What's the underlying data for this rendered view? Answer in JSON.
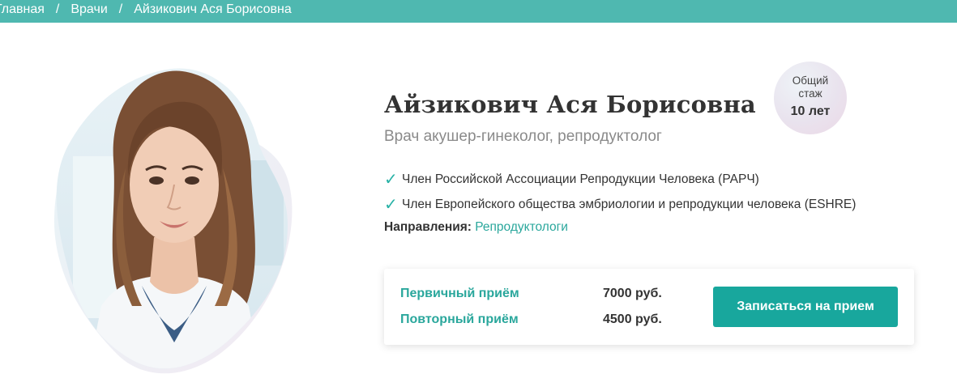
{
  "breadcrumb": {
    "items": [
      "Главная",
      "Врачи",
      "Айзикович Ася Борисовна"
    ],
    "separator": "/"
  },
  "doctor": {
    "name": "Айзикович Ася Борисовна",
    "specialty": "Врач акушер-гинеколог, репродуктолог",
    "photo_alt": "doctor-portrait",
    "memberships": [
      "Член Российской Ассоциации Репродукции Человека (РАРЧ)",
      "Член Европейского общества эмбриологии и репродукции человека (ESHRE)"
    ],
    "directions_label": "Направления:",
    "directions_value": "Репродуктологи"
  },
  "experience": {
    "label_line1": "Общий",
    "label_line2": "стаж",
    "value": "10 лет"
  },
  "prices": [
    {
      "name": "Первичный приём",
      "value": "7000 руб."
    },
    {
      "name": "Повторный приём",
      "value": "4500 руб."
    }
  ],
  "book_button": "Записаться на прием",
  "colors": {
    "topbar": "#4fb8b0",
    "accent": "#2aa79c",
    "button": "#18a79d",
    "check": "#29b2a6"
  },
  "icons": {
    "check": "check-icon"
  }
}
